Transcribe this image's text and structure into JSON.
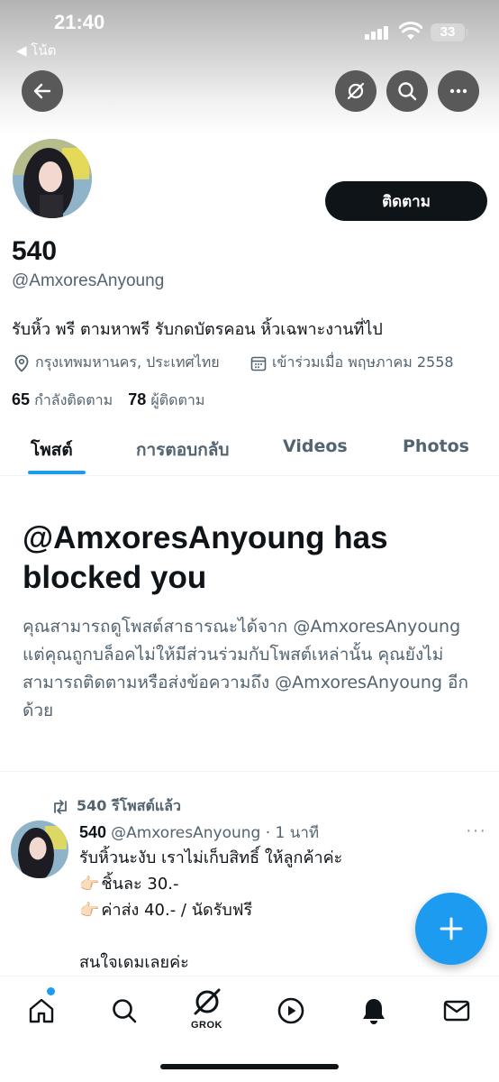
{
  "status_bar": {
    "time": "21:40",
    "back_app": "◀ โน้ต",
    "battery": "33"
  },
  "profile": {
    "follow_label": "ติดตาม",
    "display_name": "540",
    "handle": "@AmxoresAnyoung",
    "bio": "รับหิ้ว พรี ตามหาพรี รับกดบัตรคอน หิ้วเฉพาะงานที่ไป",
    "location": "กรุงเทพมหานคร, ประเทศไทย",
    "joined": "เข้าร่วมเมื่อ พฤษภาคม 2558",
    "following_count": "65",
    "following_label": "กำลังติดตาม",
    "followers_count": "78",
    "followers_label": "ผู้ติดตาม"
  },
  "tabs": [
    {
      "label": "โพสต์",
      "active": true
    },
    {
      "label": "การตอบกลับ",
      "active": false
    },
    {
      "label": "Videos",
      "active": false
    },
    {
      "label": "Photos",
      "active": false
    }
  ],
  "blocked": {
    "title": "@AmxoresAnyoung has blocked you",
    "description": "คุณสามารถดูโพสต์สาธารณะได้จาก @AmxoresAnyoung แต่คุณถูกบล็อคไม่ให้มีส่วนร่วมกับโพสต์เหล่านั้น คุณยังไม่สามารถติดตามหรือส่งข้อความถึง @AmxoresAnyoung อีกด้วย"
  },
  "tweet": {
    "repost_label": "540 รีโพสต์แล้ว",
    "name": "540",
    "handle_time": "@AmxoresAnyoung · 1 นาที",
    "more": "···",
    "lines": [
      "รับหิ้วนะงับ เราไม่เก็บสิทธิ์ ให้ลูกค้าค่ะ",
      "ชิ้นละ 30.-",
      "ค่าส่ง 40.- / นัดรับฟรี",
      "",
      "สนใจเดมเลยค่ะ"
    ]
  },
  "bottom_nav": {
    "grok_label": "GROK"
  },
  "colors": {
    "accent": "#1d9bf0",
    "text": "#0f1419",
    "secondary": "#536471"
  }
}
